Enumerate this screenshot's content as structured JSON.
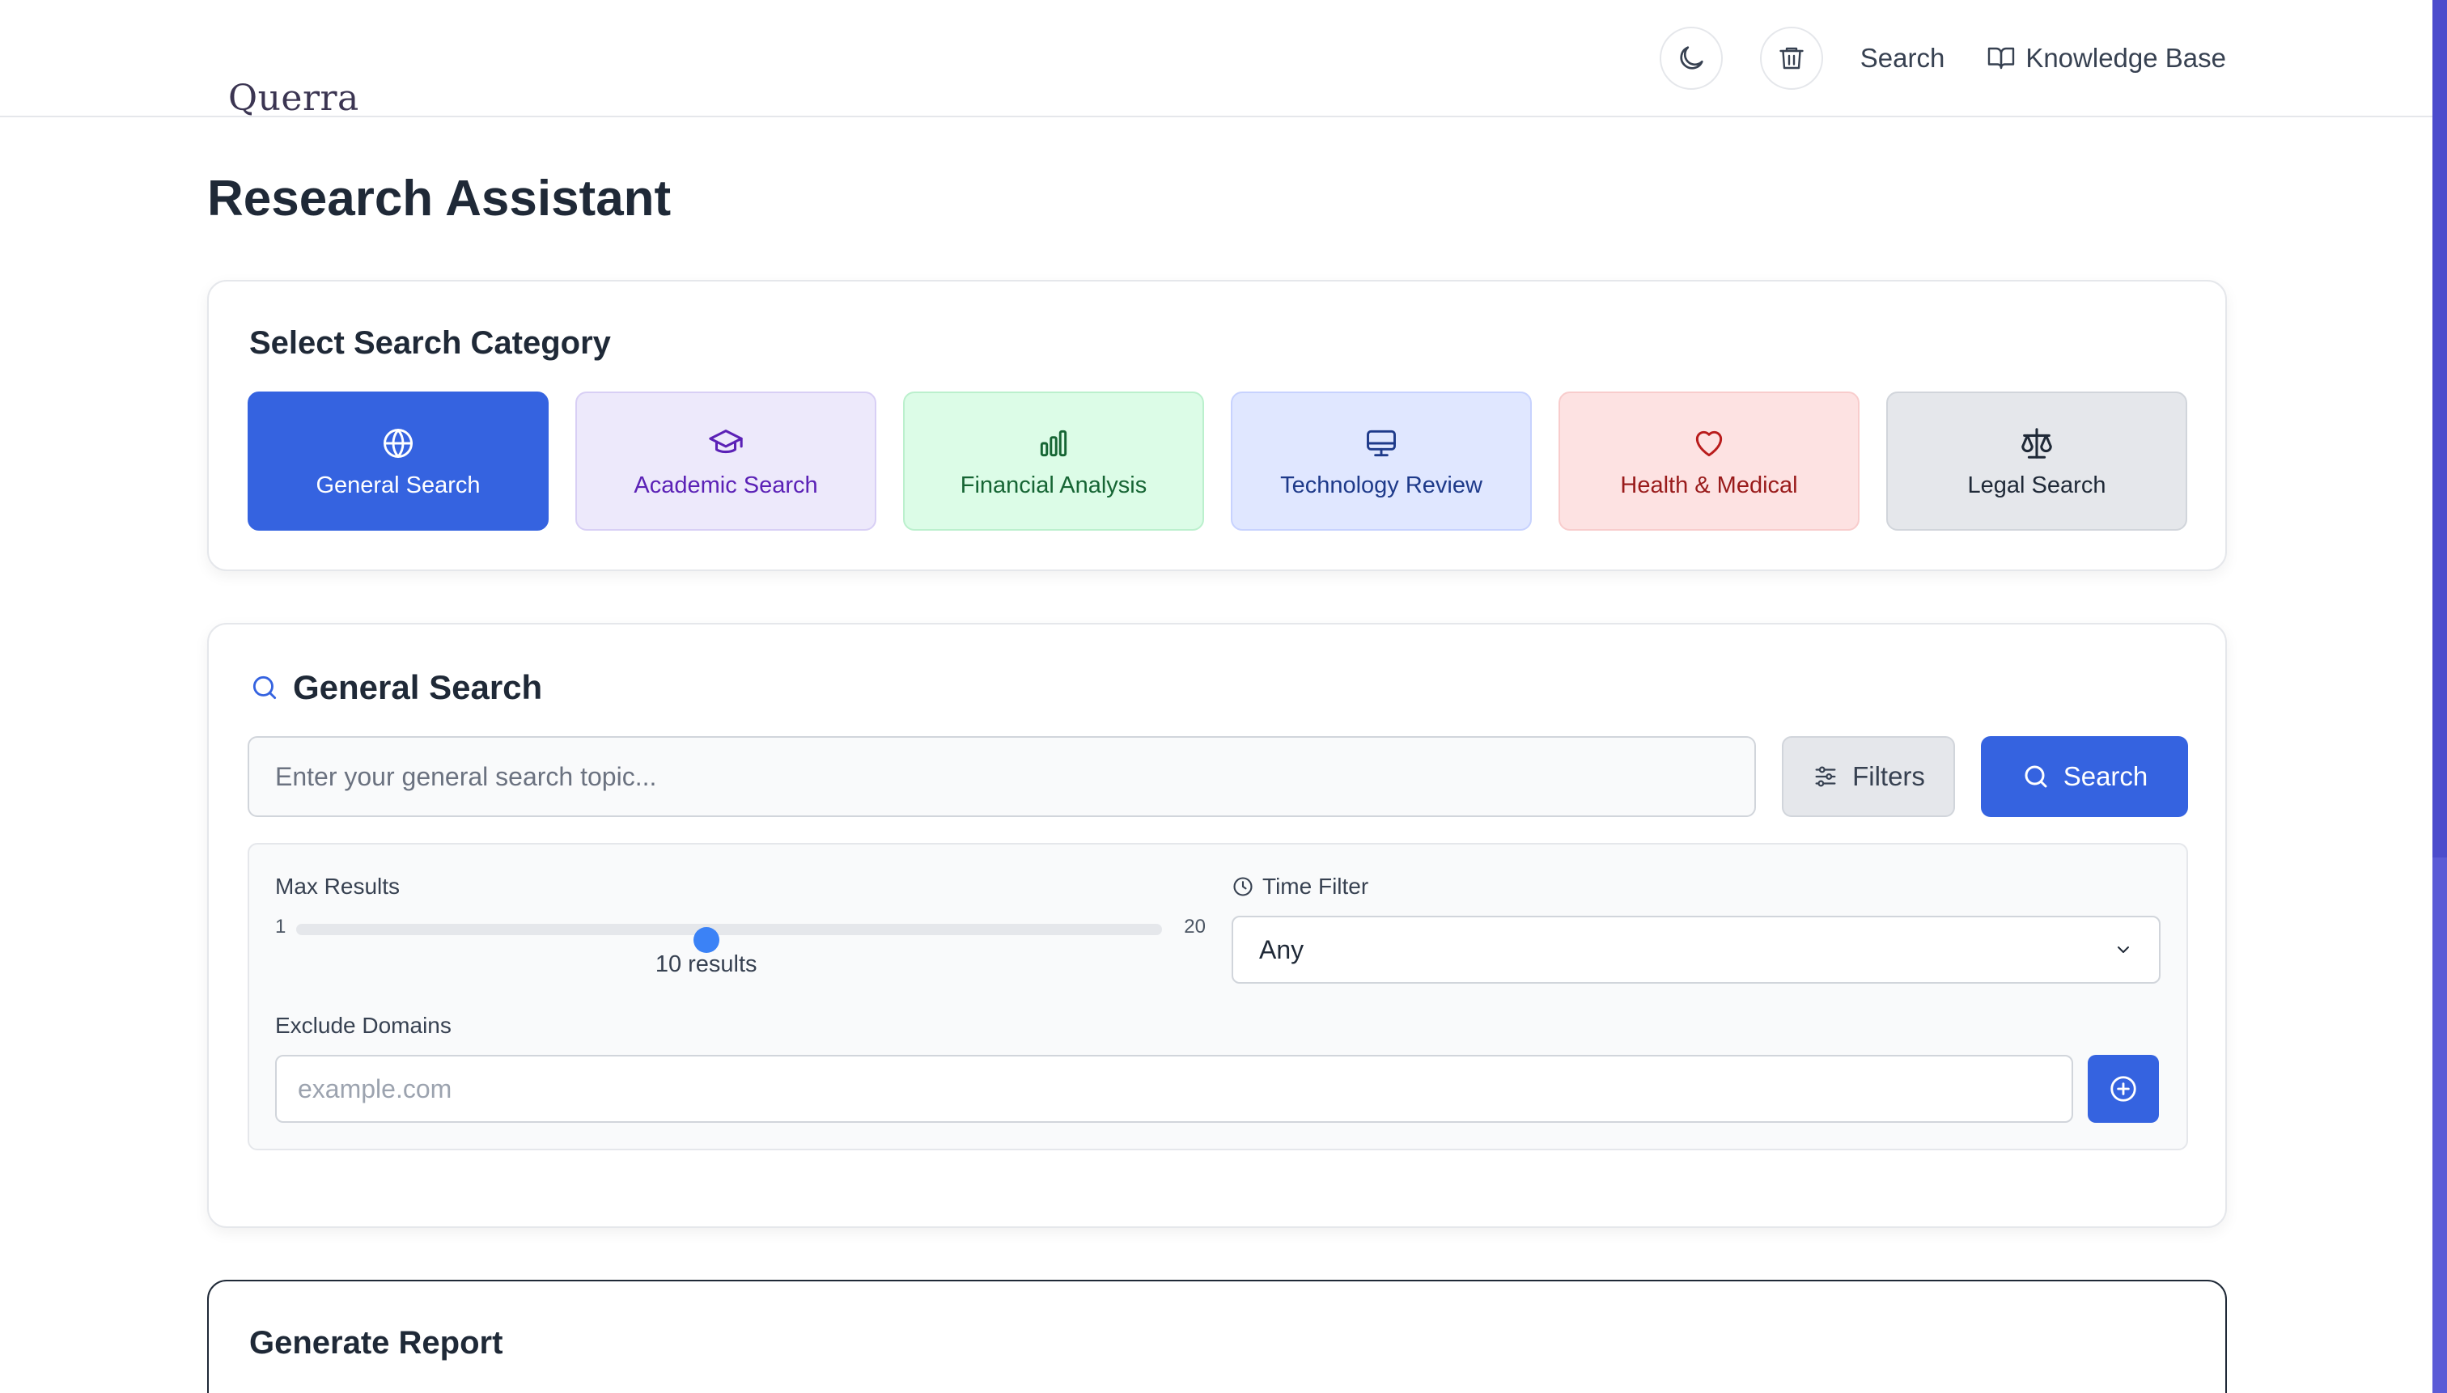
{
  "app": {
    "logo": "Querra"
  },
  "header": {
    "theme_toggle_icon": "moon-icon",
    "clear_icon": "trash-icon",
    "nav_search": "Search",
    "nav_knowledge_base": "Knowledge Base"
  },
  "page": {
    "title": "Research Assistant"
  },
  "categories": {
    "title": "Select Search Category",
    "items": [
      {
        "label": "General Search",
        "icon": "globe-icon",
        "selected": true
      },
      {
        "label": "Academic Search",
        "icon": "graduation-cap-icon"
      },
      {
        "label": "Financial Analysis",
        "icon": "bar-chart-icon"
      },
      {
        "label": "Technology Review",
        "icon": "monitor-icon"
      },
      {
        "label": "Health & Medical",
        "icon": "heart-icon"
      },
      {
        "label": "Legal Search",
        "icon": "scale-icon"
      }
    ]
  },
  "search": {
    "title": "General Search",
    "placeholder": "Enter your general search topic...",
    "filters_label": "Filters",
    "search_label": "Search",
    "max_results": {
      "label": "Max Results",
      "min": "1",
      "max": "20",
      "value": 10,
      "value_text": "10 results"
    },
    "time_filter": {
      "label": "Time Filter",
      "value": "Any"
    },
    "exclude_domains": {
      "label": "Exclude Domains",
      "placeholder": "example.com"
    }
  },
  "report": {
    "title": "Generate Report"
  },
  "colors": {
    "primary": "#3563e0",
    "accent_scrollbar": "#5b5bd6"
  }
}
